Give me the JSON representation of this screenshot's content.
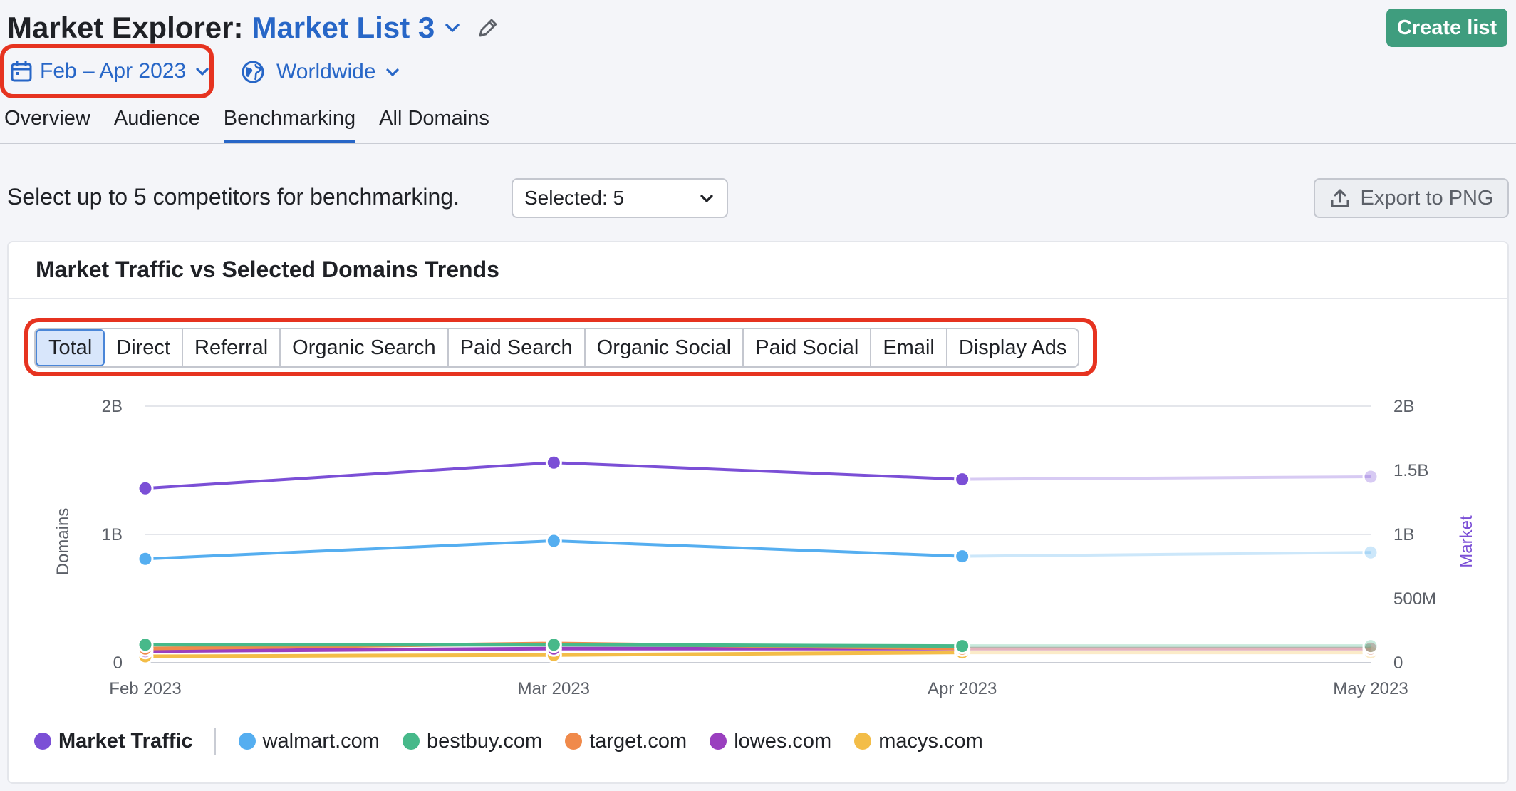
{
  "header": {
    "title_prefix": "Market Explorer:",
    "list_name": "Market List 3",
    "create_label": "Create list"
  },
  "filters": {
    "date_range": "Feb – Apr 2023",
    "region": "Worldwide"
  },
  "nav_tabs": [
    "Overview",
    "Audience",
    "Benchmarking",
    "All Domains"
  ],
  "active_tab": "Benchmarking",
  "competitors": {
    "instruction": "Select up to 5 competitors for benchmarking.",
    "selected_label": "Selected: 5",
    "export_label": "Export to PNG"
  },
  "card": {
    "title": "Market Traffic vs Selected Domains Trends"
  },
  "traffic_types": [
    "Total",
    "Direct",
    "Referral",
    "Organic Search",
    "Paid Search",
    "Organic Social",
    "Paid Social",
    "Email",
    "Display Ads"
  ],
  "active_traffic_type": "Total",
  "colors": {
    "accent_blue": "#2766c7",
    "create_green": "#3f9d7e",
    "highlight_red": "#e63320",
    "market": "#7b4fd6",
    "walmart": "#55aef0",
    "bestbuy": "#47b98a",
    "target": "#f08a4b",
    "lowes": "#9a3fbf",
    "macys": "#f3bd48"
  },
  "icons": {
    "title_chevron": "chevron-down-icon",
    "edit": "pencil-icon",
    "calendar": "calendar-icon",
    "globe": "globe-icon",
    "export": "upload-icon"
  },
  "chart_data": {
    "type": "line",
    "x": [
      "Feb 2023",
      "Mar 2023",
      "Apr 2023",
      "May 2023"
    ],
    "projected_from_index": 2,
    "y_left": {
      "label": "Domains",
      "ticks": [
        "0",
        "1B",
        "2B"
      ],
      "range": [
        0,
        2000000000
      ]
    },
    "y_right": {
      "label": "Market",
      "ticks": [
        "0",
        "500M",
        "1B",
        "1.5B",
        "2B"
      ],
      "range": [
        0,
        2000000000
      ]
    },
    "grid": true,
    "legend_position": "bottom",
    "series": [
      {
        "name": "Market Traffic",
        "key": "market",
        "axis": "right",
        "values": [
          1360000000,
          1560000000,
          1430000000,
          1450000000
        ]
      },
      {
        "name": "walmart.com",
        "key": "walmart",
        "axis": "left",
        "values": [
          810000000,
          950000000,
          830000000,
          860000000
        ]
      },
      {
        "name": "bestbuy.com",
        "key": "bestbuy",
        "axis": "left",
        "values": [
          140000000,
          140000000,
          130000000,
          130000000
        ]
      },
      {
        "name": "target.com",
        "key": "target",
        "axis": "left",
        "values": [
          110000000,
          150000000,
          110000000,
          110000000
        ]
      },
      {
        "name": "lowes.com",
        "key": "lowes",
        "axis": "left",
        "values": [
          90000000,
          110000000,
          110000000,
          110000000
        ]
      },
      {
        "name": "macys.com",
        "key": "macys",
        "axis": "left",
        "values": [
          50000000,
          60000000,
          80000000,
          80000000
        ]
      }
    ]
  }
}
